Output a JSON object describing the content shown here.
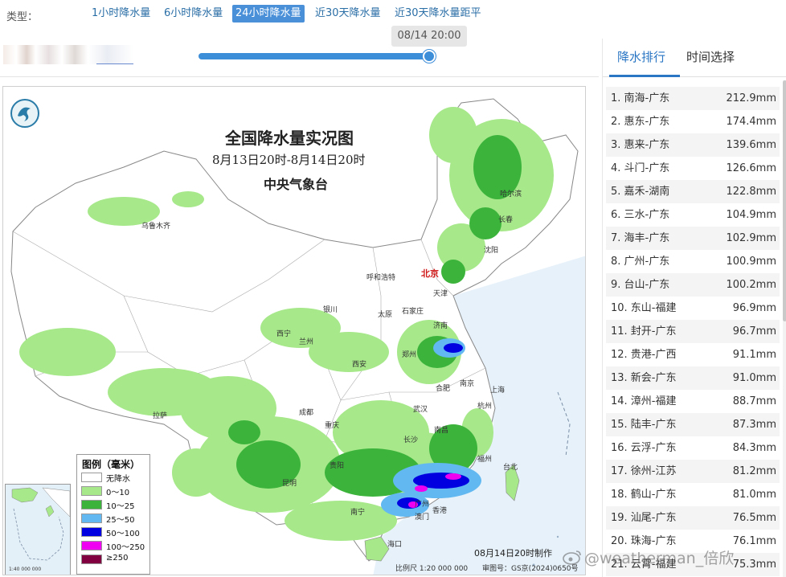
{
  "type_bar": {
    "label": "类型：",
    "tabs": [
      {
        "label": "1小时降水量",
        "active": false
      },
      {
        "label": "6小时降水量",
        "active": false
      },
      {
        "label": "24小时降水量",
        "active": true
      },
      {
        "label": "近30天降水量",
        "active": false
      },
      {
        "label": "近30天降水量距平",
        "active": false
      }
    ]
  },
  "slider": {
    "time_label": "08/14 20:00",
    "position_fraction": 1.0
  },
  "map": {
    "title": "全国降水量实况图",
    "subtitle": "8月13日20时-8月14日20时",
    "org": "中央气象台",
    "made_at": "08月14日20时制作",
    "scale": "比例尺 1:20 000 000",
    "approval": "审图号：GS京(2024)0650号",
    "inset_scale": "1:40 000 000",
    "cities": [
      {
        "name": "乌鲁木齐",
        "capital": false
      },
      {
        "name": "哈尔滨",
        "capital": false
      },
      {
        "name": "长春",
        "capital": false
      },
      {
        "name": "沈阳",
        "capital": false
      },
      {
        "name": "北京",
        "capital": true
      },
      {
        "name": "天津",
        "capital": false
      },
      {
        "name": "呼和浩特",
        "capital": false
      },
      {
        "name": "石家庄",
        "capital": false
      },
      {
        "name": "太原",
        "capital": false
      },
      {
        "name": "银川",
        "capital": false
      },
      {
        "name": "济南",
        "capital": false
      },
      {
        "name": "西宁",
        "capital": false
      },
      {
        "name": "兰州",
        "capital": false
      },
      {
        "name": "郑州",
        "capital": false
      },
      {
        "name": "西安",
        "capital": false
      },
      {
        "name": "合肥",
        "capital": false
      },
      {
        "name": "南京",
        "capital": false
      },
      {
        "name": "上海",
        "capital": false
      },
      {
        "name": "武汉",
        "capital": false
      },
      {
        "name": "杭州",
        "capital": false
      },
      {
        "name": "拉萨",
        "capital": false
      },
      {
        "name": "成都",
        "capital": false
      },
      {
        "name": "重庆",
        "capital": false
      },
      {
        "name": "长沙",
        "capital": false
      },
      {
        "name": "南昌",
        "capital": false
      },
      {
        "name": "福州",
        "capital": false
      },
      {
        "name": "台北",
        "capital": false
      },
      {
        "name": "贵阳",
        "capital": false
      },
      {
        "name": "昆明",
        "capital": false
      },
      {
        "name": "南宁",
        "capital": false
      },
      {
        "name": "广州",
        "capital": false
      },
      {
        "name": "香港",
        "capital": false
      },
      {
        "name": "澳门",
        "capital": false
      },
      {
        "name": "海口",
        "capital": false
      }
    ],
    "legend": {
      "title": "图例（毫米）",
      "items": [
        {
          "label": "无降水",
          "color": "#ffffff"
        },
        {
          "label": "0～10",
          "color": "#a6e88a"
        },
        {
          "label": "10～25",
          "color": "#3cb43c"
        },
        {
          "label": "25～50",
          "color": "#62b8f0"
        },
        {
          "label": "50～100",
          "color": "#0000e0"
        },
        {
          "label": "100～250",
          "color": "#f000f0"
        },
        {
          "label": "≥250",
          "color": "#800040"
        }
      ]
    }
  },
  "side_panel": {
    "tabs": [
      {
        "label": "降水排行",
        "active": true
      },
      {
        "label": "时间选择",
        "active": false
      }
    ],
    "ranking": [
      {
        "name": "1. 南海-广东",
        "value": "212.9mm"
      },
      {
        "name": "2. 惠东-广东",
        "value": "174.4mm"
      },
      {
        "name": "3. 惠来-广东",
        "value": "139.6mm"
      },
      {
        "name": "4. 斗门-广东",
        "value": "126.6mm"
      },
      {
        "name": "5. 嘉禾-湖南",
        "value": "122.8mm"
      },
      {
        "name": "6. 三水-广东",
        "value": "104.9mm"
      },
      {
        "name": "7. 海丰-广东",
        "value": "102.9mm"
      },
      {
        "name": "8. 广州-广东",
        "value": "100.9mm"
      },
      {
        "name": "9. 台山-广东",
        "value": "100.2mm"
      },
      {
        "name": "10. 东山-福建",
        "value": "96.9mm"
      },
      {
        "name": "11. 封开-广东",
        "value": "96.7mm"
      },
      {
        "name": "12. 贵港-广西",
        "value": "91.1mm"
      },
      {
        "name": "13. 新会-广东",
        "value": "91.0mm"
      },
      {
        "name": "14. 漳州-福建",
        "value": "88.7mm"
      },
      {
        "name": "15. 陆丰-广东",
        "value": "87.3mm"
      },
      {
        "name": "16. 云浮-广东",
        "value": "84.3mm"
      },
      {
        "name": "17. 徐州-江苏",
        "value": "81.2mm"
      },
      {
        "name": "18. 鹤山-广东",
        "value": "81.0mm"
      },
      {
        "name": "19. 汕尾-广东",
        "value": "76.5mm"
      },
      {
        "name": "20. 珠海-广东",
        "value": "76.1mm"
      },
      {
        "name": "21. 云霄-福建",
        "value": "75.3mm"
      }
    ]
  },
  "watermark": "@weatherman_倍欣"
}
